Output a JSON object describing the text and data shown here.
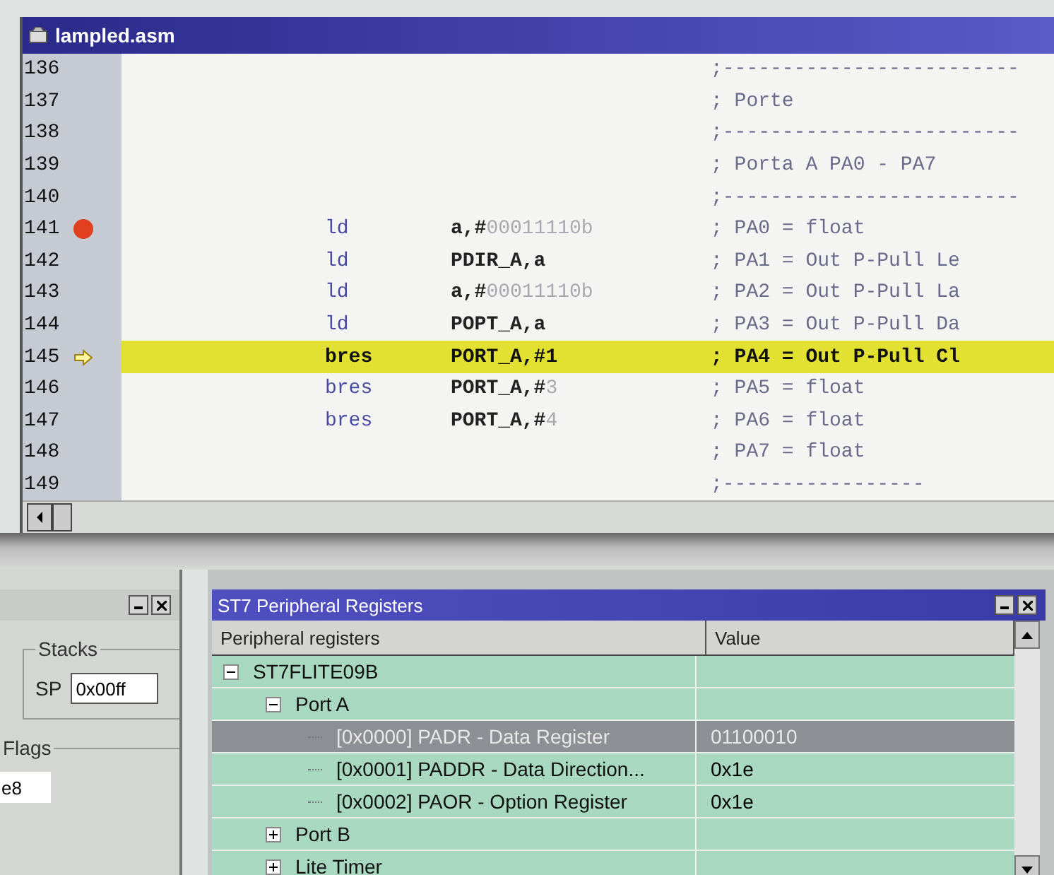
{
  "editor": {
    "title": "lampled.asm",
    "lines": [
      {
        "number": "136",
        "breakpoint": false,
        "current": false,
        "comment": ";-------------------------"
      },
      {
        "number": "137",
        "breakpoint": false,
        "current": false,
        "comment": "; Porte"
      },
      {
        "number": "138",
        "breakpoint": false,
        "current": false,
        "comment": ";-------------------------"
      },
      {
        "number": "139",
        "breakpoint": false,
        "current": false,
        "comment": "; Porta A PA0 - PA7"
      },
      {
        "number": "140",
        "breakpoint": false,
        "current": false,
        "comment": ";-------------------------"
      },
      {
        "number": "141",
        "breakpoint": true,
        "current": false,
        "mnemonic": "ld",
        "operand": "a,#",
        "literal": "00011110b",
        "comment": "; PA0 = float"
      },
      {
        "number": "142",
        "breakpoint": false,
        "current": false,
        "mnemonic": "ld",
        "operand": "PDIR_A,a",
        "comment": "; PA1 = Out P-Pull Le"
      },
      {
        "number": "143",
        "breakpoint": false,
        "current": false,
        "mnemonic": "ld",
        "operand": "a,#",
        "literal": "00011110b",
        "comment": "; PA2 = Out P-Pull La"
      },
      {
        "number": "144",
        "breakpoint": false,
        "current": false,
        "mnemonic": "ld",
        "operand": "POPT_A,a",
        "comment": "; PA3 = Out P-Pull Da"
      },
      {
        "number": "145",
        "breakpoint": false,
        "current": true,
        "mnemonic": "bres",
        "operand": "PORT_A,#1",
        "comment": "; PA4 = Out P-Pull Cl"
      },
      {
        "number": "146",
        "breakpoint": false,
        "current": false,
        "mnemonic": "bres",
        "operand": "PORT_A,#",
        "literal": "3",
        "comment": "; PA5 = float"
      },
      {
        "number": "147",
        "breakpoint": false,
        "current": false,
        "mnemonic": "bres",
        "operand": "PORT_A,#",
        "literal": "4",
        "comment": "; PA6 = float"
      },
      {
        "number": "148",
        "breakpoint": false,
        "current": false,
        "comment": "; PA7 = float"
      },
      {
        "number": "149",
        "breakpoint": false,
        "current": false,
        "comment": ";-----------------"
      }
    ]
  },
  "left_panel": {
    "stacks": {
      "label": "Stacks",
      "sp_label": "SP",
      "sp_value": "0x00ff"
    },
    "flags": {
      "label": "Flags",
      "value": "e8"
    }
  },
  "registers": {
    "title": "ST7 Peripheral Registers",
    "columns": [
      "Peripheral registers",
      "Value"
    ],
    "tree": [
      {
        "label": "ST7FLITE09B",
        "expanded": true,
        "selected": false,
        "children": [
          {
            "label": "Port A",
            "expanded": true,
            "selected": false,
            "children": [
              {
                "label": "[0x0000] PADR - Data Register",
                "value": "01100010",
                "selected": true
              },
              {
                "label": "[0x0001] PADDR - Data Direction...",
                "value": "0x1e",
                "selected": false
              },
              {
                "label": "[0x0002] PAOR - Option Register",
                "value": "0x1e",
                "selected": false
              }
            ]
          },
          {
            "label": "Port B",
            "expanded": false,
            "selected": false
          },
          {
            "label": "Lite Timer",
            "expanded": false,
            "selected": false
          }
        ]
      }
    ]
  }
}
